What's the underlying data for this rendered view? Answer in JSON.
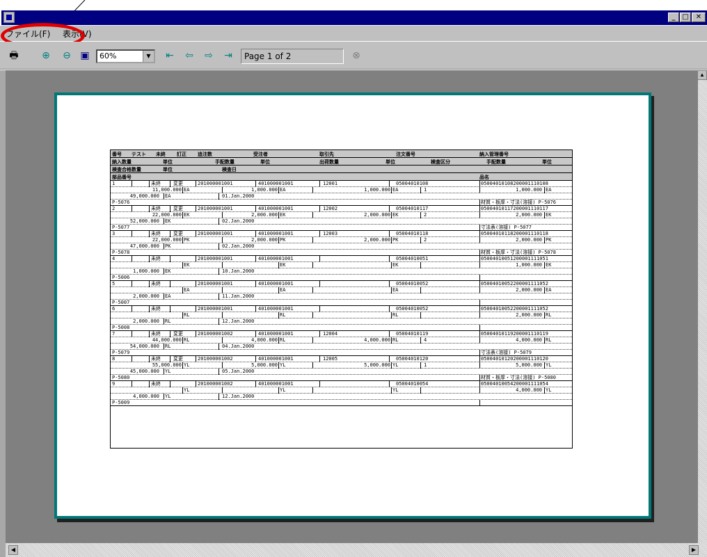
{
  "menu": {
    "file": "ファイル(F)",
    "view": "表示(V)"
  },
  "toolbar": {
    "zoom": "60%",
    "page_label": "Page 1 of 2"
  },
  "header": {
    "row1": [
      "番号",
      "テスト",
      "未終",
      "訂正",
      "追注数",
      "",
      "受注者",
      "",
      "取引先",
      "",
      "注文番号",
      "",
      "納入管理番号",
      ""
    ],
    "row2": [
      "納入数量",
      "",
      "単位",
      "",
      "手配数量",
      "単位",
      "",
      "出荷数量",
      "",
      "単位",
      "検査区分",
      "",
      "手配数量",
      "単位"
    ],
    "row3": [
      "検査合格数量",
      "",
      "単位",
      "",
      "検査日"
    ],
    "row4": [
      "部品番号",
      "",
      "",
      "",
      "",
      "",
      "",
      "",
      "",
      "",
      "",
      "",
      "品名"
    ]
  },
  "rows": [
    {
      "no": "1",
      "f1": "未終",
      "f2": "変更",
      "ord": "201000001001",
      "rcv": "401000001001",
      "sup": "12001",
      "po": "05004010108",
      "mg": "05004010108200001110108"
    },
    {
      "q1": "11,000.000",
      "u1": "EA",
      "q2": "1,000.000",
      "u2": "EA",
      "q3": "1,000.000",
      "u3": "EA",
      "k": "1",
      "q4": "1,000.000",
      "u4": "EA"
    },
    {
      "q5": "49,000.000",
      "u5": "EA",
      "d": "01.Jan.2000"
    },
    {
      "pn": "P-5076",
      "nm": "材質・板厚・寸法(溶接) P-5076"
    },
    {
      "no": "2",
      "f1": "未終",
      "f2": "変更",
      "ord": "201000001001",
      "rcv": "401000001001",
      "sup": "12002",
      "po": "05004010117",
      "mg": "05004010117200001110117"
    },
    {
      "q1": "22,000.000",
      "u1": "EK",
      "q2": "2,000.000",
      "u2": "EK",
      "q3": "2,000.000",
      "u3": "EK",
      "k": "2",
      "q4": "2,000.000",
      "u4": "EK"
    },
    {
      "q5": "52,000.000",
      "u5": "EK",
      "d": "02.Jan.2000"
    },
    {
      "pn": "P-5077",
      "nm": "寸法表(溶接) P-5077"
    },
    {
      "no": "3",
      "f1": "未終",
      "f2": "変更",
      "ord": "201000001001",
      "rcv": "401000001001",
      "sup": "12003",
      "po": "05004010118",
      "mg": "05004010118200001110118"
    },
    {
      "q1": "22,000.000",
      "u1": "PK",
      "q2": "2,000.000",
      "u2": "PK",
      "q3": "2,000.000",
      "u3": "PK",
      "k": "2",
      "q4": "2,000.000",
      "u4": "PK"
    },
    {
      "q5": "47,000.000",
      "u5": "PK",
      "d": "02.Jan.2000"
    },
    {
      "pn": "P-5078",
      "nm": "材質・板厚・寸法(溶接) P-5078"
    },
    {
      "no": "4",
      "f1": "未終",
      "f2": "",
      "ord": "201000001001",
      "rcv": "401000001001",
      "sup": "",
      "po": "05004010051",
      "mg": "05004010051200001111051"
    },
    {
      "q1": "",
      "u1": "EK",
      "q2": "",
      "u2": "EK",
      "q3": "",
      "u3": "EK",
      "k": "",
      "q4": "1,000.000",
      "u4": "EK"
    },
    {
      "q5": "1,000.000",
      "u5": "EK",
      "d": "10.Jan.2000"
    },
    {
      "pn": "P-5006",
      "nm": ""
    },
    {
      "no": "5",
      "f1": "未終",
      "f2": "",
      "ord": "201000001001",
      "rcv": "401000001001",
      "sup": "",
      "po": "05004010052",
      "mg": "05004010052200001111052"
    },
    {
      "q1": "",
      "u1": "EA",
      "q2": "",
      "u2": "EA",
      "q3": "",
      "u3": "EA",
      "k": "",
      "q4": "2,000.000",
      "u4": "EA"
    },
    {
      "q5": "2,000.000",
      "u5": "EA",
      "d": "11.Jan.2000"
    },
    {
      "pn": "P-5007",
      "nm": ""
    },
    {
      "no": "6",
      "f1": "未終",
      "f2": "",
      "ord": "201000001001",
      "rcv": "401000001001",
      "sup": "",
      "po": "05004010052",
      "mg": "05004010052200001111052"
    },
    {
      "q1": "",
      "u1": "RL",
      "q2": "",
      "u2": "RL",
      "q3": "",
      "u3": "RL",
      "k": "",
      "q4": "2,000.000",
      "u4": "RL"
    },
    {
      "q5": "2,000.000",
      "u5": "RL",
      "d": "12.Jan.2000"
    },
    {
      "pn": "P-5008",
      "nm": ""
    },
    {
      "no": "7",
      "f1": "未終",
      "f2": "変更",
      "ord": "201000001002",
      "rcv": "401000001001",
      "sup": "12004",
      "po": "05004010119",
      "mg": "05004010119200001110119"
    },
    {
      "q1": "44,000.000",
      "u1": "RL",
      "q2": "4,000.000",
      "u2": "RL",
      "q3": "4,000.000",
      "u3": "RL",
      "k": "4",
      "q4": "4,000.000",
      "u4": "RL"
    },
    {
      "q5": "54,000.000",
      "u5": "RL",
      "d": "04.Jan.2000"
    },
    {
      "pn": "P-5079",
      "nm": "寸法表(溶接) P-5079"
    },
    {
      "no": "8",
      "f1": "未終",
      "f2": "変更",
      "ord": "201000001002",
      "rcv": "401000001001",
      "sup": "12005",
      "po": "05004010120",
      "mg": "05004010120200001110120"
    },
    {
      "q1": "55,000.000",
      "u1": "YL",
      "q2": "5,000.000",
      "u2": "YL",
      "q3": "5,000.000",
      "u3": "YL",
      "k": "1",
      "q4": "5,000.000",
      "u4": "YL"
    },
    {
      "q5": "45,000.000",
      "u5": "YL",
      "d": "05.Jan.2000"
    },
    {
      "pn": "P-5080",
      "nm": "材質・板厚・寸法(溶接) P-5080"
    },
    {
      "no": "9",
      "f1": "未終",
      "f2": "",
      "ord": "201000001002",
      "rcv": "401000001001",
      "sup": "",
      "po": "05004010054",
      "mg": "05004010054200001111054"
    },
    {
      "q1": "",
      "u1": "YL",
      "q2": "",
      "u2": "YL",
      "q3": "",
      "u3": "YL",
      "k": "",
      "q4": "4,000.000",
      "u4": "YL"
    },
    {
      "q5": "4,000.000",
      "u5": "YL",
      "d": "12.Jan.2000"
    },
    {
      "pn": "P-5009",
      "nm": ""
    }
  ]
}
